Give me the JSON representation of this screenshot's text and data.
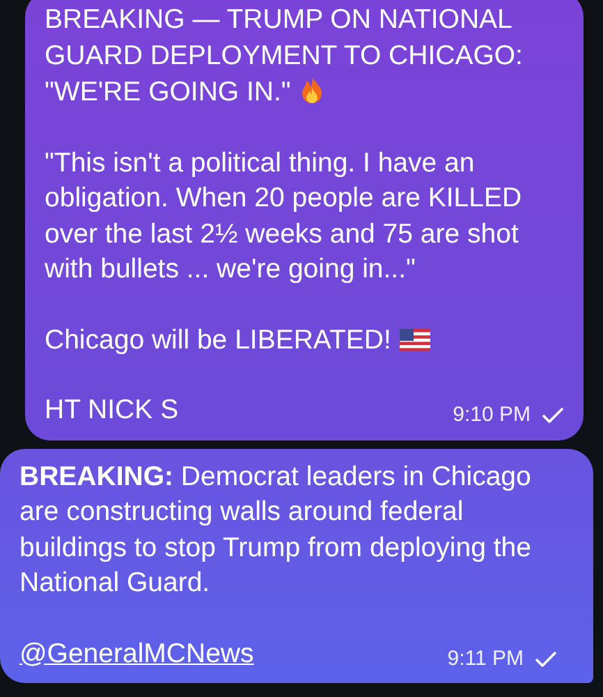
{
  "messages": [
    {
      "paragraphs": [
        {
          "text": "BREAKING — TRUMP ON NATIONAL GUARD DEPLOYMENT TO CHICAGO: \"WE'RE GOING IN.\"",
          "kind": "fire"
        },
        {
          "text": "\"This isn't a political thing. I have an obligation. When 20 people are KILLED over the last 2½ weeks and 75 are shot with bullets ... we're going in...\""
        },
        {
          "text": "Chicago will be LIBERATED!",
          "kind": "flag"
        },
        {
          "text": "HT NICK S"
        }
      ],
      "time": "9:10 PM",
      "sent": true,
      "tail": false
    },
    {
      "paragraphs": [
        {
          "text": "**BREAKING:** Democrat leaders in Chicago are constructing walls around federal buildings to stop Trump from deploying the National Guard."
        },
        {
          "text": "@GeneralMCNews",
          "kind": "link"
        }
      ],
      "time": "9:11 PM",
      "sent": true,
      "tail": true
    }
  ]
}
